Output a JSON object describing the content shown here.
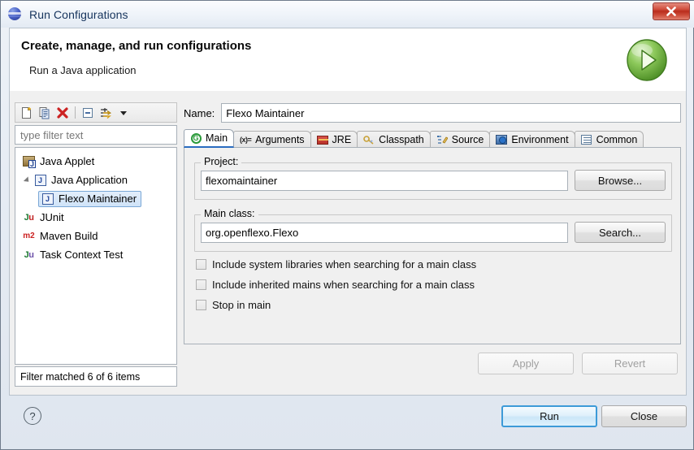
{
  "window": {
    "title": "Run Configurations",
    "title_icon": "eclipse-globe-icon",
    "close_label": "✕"
  },
  "banner": {
    "title": "Create, manage, and run configurations",
    "subtitle": "Run a Java application",
    "badge_icon": "run-play-icon"
  },
  "left_panel": {
    "toolbar": [
      {
        "name": "new-configuration",
        "icon": "new-page-icon"
      },
      {
        "name": "duplicate-configuration",
        "icon": "copy-pages-icon"
      },
      {
        "name": "delete-configuration",
        "icon": "red-x-icon"
      },
      {
        "name": "collapse-all",
        "icon": "collapse-all-icon"
      },
      {
        "name": "filter-launch-configurations",
        "icon": "filter-arrows-icon"
      },
      {
        "name": "view-menu",
        "icon": "chevron-down-icon"
      }
    ],
    "filter_placeholder": "type filter text",
    "filter_value": "",
    "tree": [
      {
        "label": "Java Applet",
        "icon": "java-applet-icon",
        "level": 0,
        "expandable": false,
        "selected": false
      },
      {
        "label": "Java Application",
        "icon": "java-application-icon",
        "level": 0,
        "expandable": true,
        "expanded": true,
        "selected": false
      },
      {
        "label": "Flexo Maintainer",
        "icon": "java-application-icon",
        "level": 1,
        "expandable": false,
        "selected": true
      },
      {
        "label": "JUnit",
        "icon": "junit-icon",
        "level": 0,
        "expandable": false,
        "selected": false
      },
      {
        "label": "Maven Build",
        "icon": "maven-icon",
        "level": 0,
        "expandable": false,
        "selected": false
      },
      {
        "label": "Task Context Test",
        "icon": "task-context-icon",
        "level": 0,
        "expandable": false,
        "selected": false
      }
    ],
    "status": "Filter matched 6 of 6 items"
  },
  "config": {
    "name_label": "Name:",
    "name_value": "Flexo Maintainer",
    "tabs": [
      {
        "label": "Main",
        "icon": "main-green-circle-icon",
        "active": true
      },
      {
        "label": "Arguments",
        "icon": "arguments-icon",
        "active": false
      },
      {
        "label": "JRE",
        "icon": "jre-icon",
        "active": false
      },
      {
        "label": "Classpath",
        "icon": "classpath-icon",
        "active": false
      },
      {
        "label": "Source",
        "icon": "source-icon",
        "active": false
      },
      {
        "label": "Environment",
        "icon": "environment-icon",
        "active": false
      },
      {
        "label": "Common",
        "icon": "common-icon",
        "active": false
      }
    ],
    "project_group_label": "Project:",
    "project_value": "flexomaintainer",
    "browse_label": "Browse...",
    "main_class_group_label": "Main class:",
    "main_class_value": "org.openflexo.Flexo",
    "search_label": "Search...",
    "checkboxes": [
      {
        "label": "Include system libraries when searching for a main class",
        "checked": false
      },
      {
        "label": "Include inherited mains when searching for a main class",
        "checked": false
      },
      {
        "label": "Stop in main",
        "checked": false
      }
    ],
    "apply_label": "Apply",
    "apply_enabled": false,
    "revert_label": "Revert",
    "revert_enabled": false
  },
  "footer": {
    "help_label": "?",
    "run_label": "Run",
    "close_label": "Close"
  },
  "colors": {
    "accent": "#2a6cc0",
    "run_green": "#5aa832",
    "close_red": "#ba2d1d",
    "selection_blue": "#7aa7d6"
  }
}
